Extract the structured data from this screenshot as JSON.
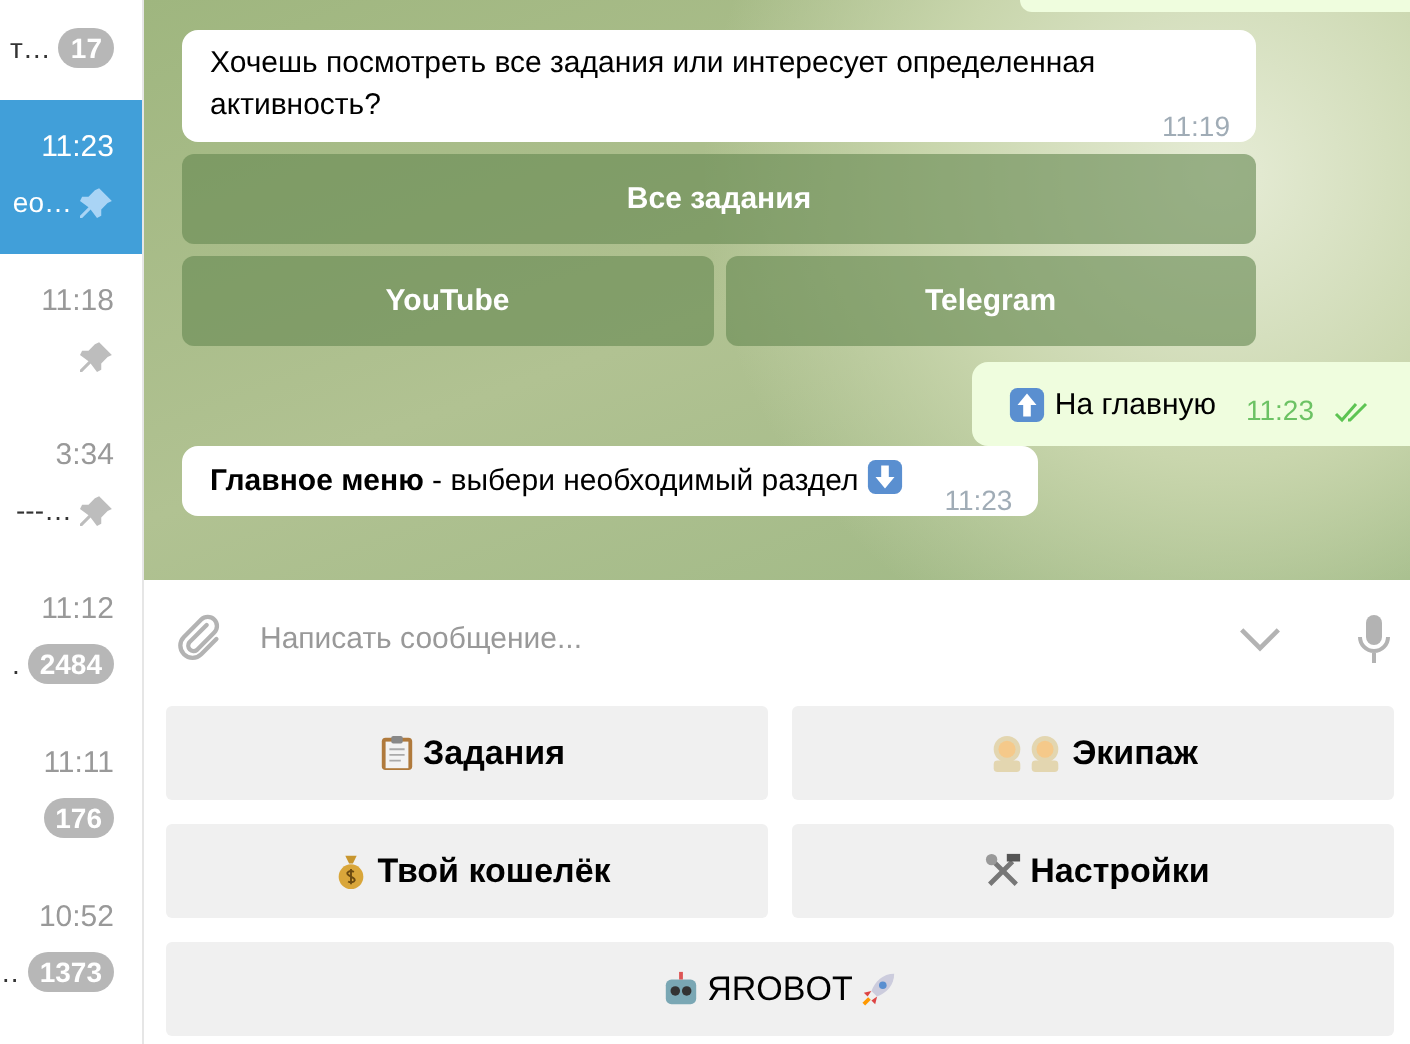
{
  "chats": [
    {
      "preview": "т…",
      "badge": "17",
      "pinned": false,
      "selected": false
    },
    {
      "time": "11:23",
      "preview": "ео…",
      "pinned": true,
      "selected": true
    },
    {
      "time": "11:18",
      "pinned": true,
      "selected": false
    },
    {
      "time": "3:34",
      "preview": "---…",
      "pinned": true,
      "selected": false
    },
    {
      "time": "11:12",
      "preview": ".",
      "badge": "2484",
      "pinned": false,
      "selected": false
    },
    {
      "time": "11:11",
      "badge": "176",
      "pinned": false,
      "selected": false
    },
    {
      "time": "10:52",
      "preview": "…",
      "badge": "1373",
      "pinned": false,
      "selected": false
    }
  ],
  "messages": [
    {
      "kind": "partial_out"
    },
    {
      "kind": "in",
      "text": "Хочешь посмотреть все задания или интересует определенная активность?",
      "time": "11:19",
      "keyboard": [
        [
          "Все задания"
        ],
        [
          "YouTube",
          "Telegram"
        ]
      ]
    },
    {
      "kind": "out",
      "text": "На главную",
      "time": "11:23",
      "read": true
    },
    {
      "kind": "in",
      "text": "**Главное меню** - выбери необходимый раздел",
      "time": "11:23"
    }
  ],
  "composer": {
    "placeholder": "Написать сообщение..."
  },
  "reply_keyboard": [
    [
      "Задания",
      "Экипаж"
    ],
    [
      "Твой кошелёк",
      "Настройки"
    ],
    [
      "ЯROBOT"
    ]
  ]
}
